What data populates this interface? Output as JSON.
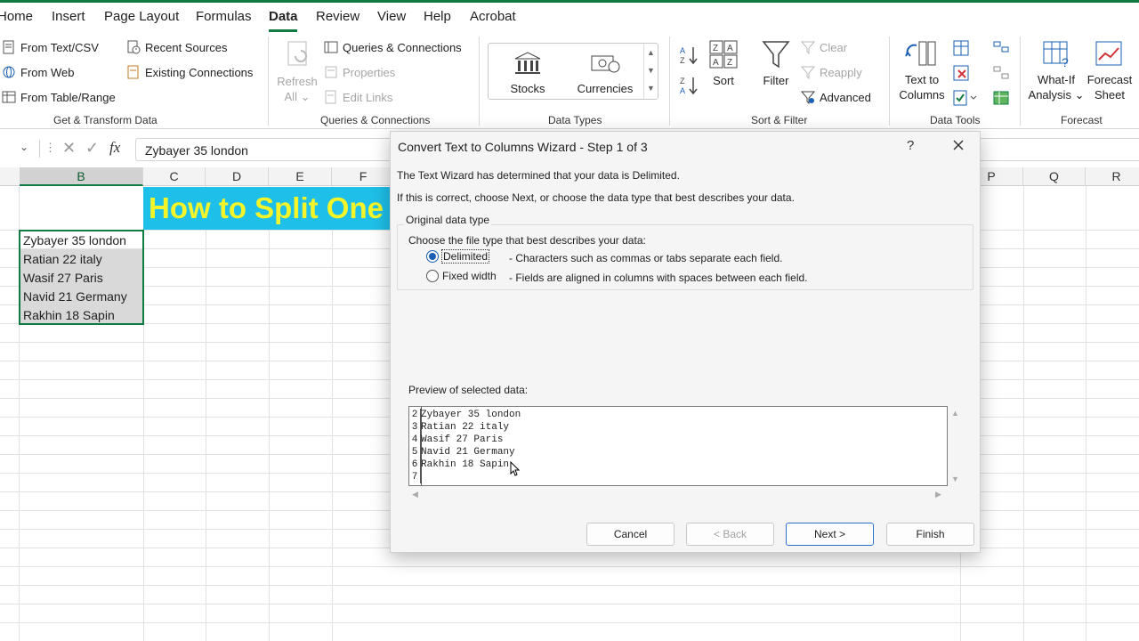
{
  "ribbon_tabs": [
    "Home",
    "Insert",
    "Page Layout",
    "Formulas",
    "Data",
    "Review",
    "View",
    "Help",
    "Acrobat"
  ],
  "active_tab": "Data",
  "get_transform": {
    "items": [
      "From Text/CSV",
      "From Web",
      "From Table/Range",
      "Recent Sources",
      "Existing Connections"
    ],
    "label": "Get & Transform Data"
  },
  "queries": {
    "refresh": "Refresh",
    "all": "All",
    "items": [
      "Queries & Connections",
      "Properties",
      "Edit Links"
    ],
    "label": "Queries & Connections"
  },
  "data_types": {
    "stocks": "Stocks",
    "currencies": "Currencies",
    "label": "Data Types"
  },
  "sort_filter": {
    "sort": "Sort",
    "filter": "Filter",
    "clear": "Clear",
    "reapply": "Reapply",
    "advanced": "Advanced",
    "label": "Sort & Filter"
  },
  "data_tools": {
    "text_to": "Text to",
    "columns": "Columns",
    "label": "Data Tools"
  },
  "forecast": {
    "what_if": "What-If",
    "analysis": "Analysis",
    "forecast_l1": "Forecast",
    "forecast_l2": "Sheet",
    "label": "Forecast"
  },
  "formula_bar": {
    "value": "Zybayer 35 london"
  },
  "columns_left": [
    "B",
    "C",
    "D",
    "E",
    "F"
  ],
  "columns_right": [
    "P",
    "Q",
    "R"
  ],
  "banner_text": "How to Split One",
  "cells": [
    "Zybayer 35 london",
    "Ratian 22 italy",
    "Wasif 27 Paris",
    "Navid 21 Germany",
    "Rakhin 18 Sapin"
  ],
  "dialog": {
    "title": "Convert Text to Columns Wizard - Step 1 of 3",
    "help": "?",
    "line1": "The Text Wizard has determined that your data is Delimited.",
    "line2": "If this is correct, choose Next, or choose the data type that best describes your data.",
    "group_label": "Original data type",
    "choose_label": "Choose the file type that best describes your data:",
    "option1": "Delimited",
    "option1_desc": "- Characters such as commas or tabs separate each field.",
    "option2": "Fixed width",
    "option2_desc": "- Fields are aligned in columns with spaces between each field.",
    "preview_label": "Preview of selected data:",
    "preview_rows": [
      {
        "n": "2",
        "text": "Zybayer 35 london"
      },
      {
        "n": "3",
        "text": "Ratian 22 italy"
      },
      {
        "n": "4",
        "text": "Wasif 27 Paris"
      },
      {
        "n": "5",
        "text": "Navid 21 Germany"
      },
      {
        "n": "6",
        "text": "Rakhin 18 Sapin"
      },
      {
        "n": "7",
        "text": ""
      }
    ],
    "buttons": {
      "cancel": "Cancel",
      "back": "< Back",
      "next": "Next >",
      "finish": "Finish"
    }
  },
  "colors": {
    "excel_green": "#107c41",
    "banner_bg": "#1ebfe8",
    "banner_text": "#f3f52a"
  }
}
